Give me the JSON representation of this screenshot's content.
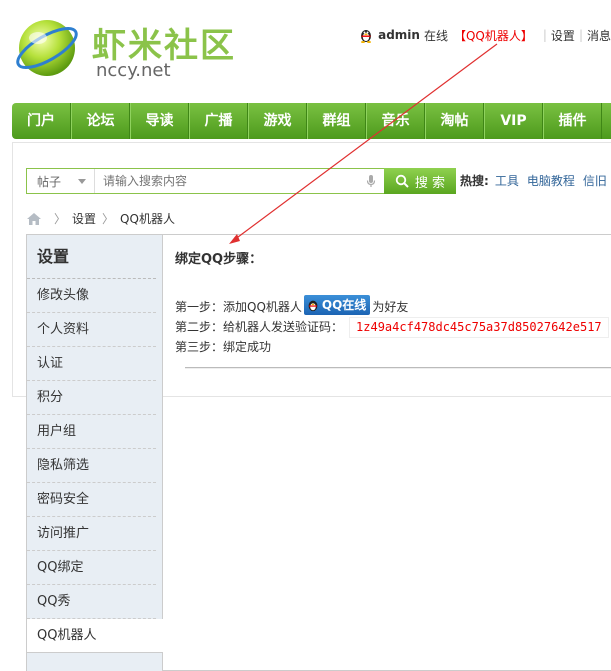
{
  "header": {
    "logo_cn": "虾米社区",
    "logo_en": "nccy.net",
    "username": "admin",
    "status": "在线",
    "qqbot_link": "【QQ机器人】",
    "settings_link": "设置",
    "messages_link": "消息"
  },
  "nav": {
    "items": [
      {
        "label": "门户"
      },
      {
        "label": "论坛"
      },
      {
        "label": "导读"
      },
      {
        "label": "广播"
      },
      {
        "label": "游戏"
      },
      {
        "label": "群组"
      },
      {
        "label": "音乐"
      },
      {
        "label": "淘帖"
      },
      {
        "label": "VIP"
      },
      {
        "label": "插件"
      }
    ]
  },
  "search": {
    "type_selected": "帖子",
    "placeholder": "请输入搜索内容",
    "button_label": "搜 索",
    "hot_label": "热搜:",
    "hot_links": [
      "工具",
      "电脑教程",
      "信旧"
    ]
  },
  "breadcrumb": {
    "items": [
      "设置",
      "QQ机器人"
    ]
  },
  "sidebar": {
    "title": "设置",
    "items": [
      {
        "label": "修改头像"
      },
      {
        "label": "个人资料"
      },
      {
        "label": "认证"
      },
      {
        "label": "积分"
      },
      {
        "label": "用户组"
      },
      {
        "label": "隐私筛选"
      },
      {
        "label": "密码安全"
      },
      {
        "label": "访问推广"
      },
      {
        "label": "QQ绑定"
      },
      {
        "label": "QQ秀"
      },
      {
        "label": "QQ机器人"
      }
    ],
    "active_index": 10
  },
  "main": {
    "title": "绑定QQ步骤：",
    "step1_prefix": "第一步：添加QQ机器人",
    "qq_button_label": "QQ在线",
    "step1_suffix": "为好友",
    "step2_prefix": "第二步：给机器人发送验证码：",
    "verify_code": "1z49a4cf478dc45c75a37d85027642e517",
    "step3": "第三步：绑定成功"
  },
  "colors": {
    "nav_green": "#5aa620",
    "accent_red": "#e00000",
    "sidebar_bg": "#e8eef4",
    "link_blue": "#336699"
  }
}
